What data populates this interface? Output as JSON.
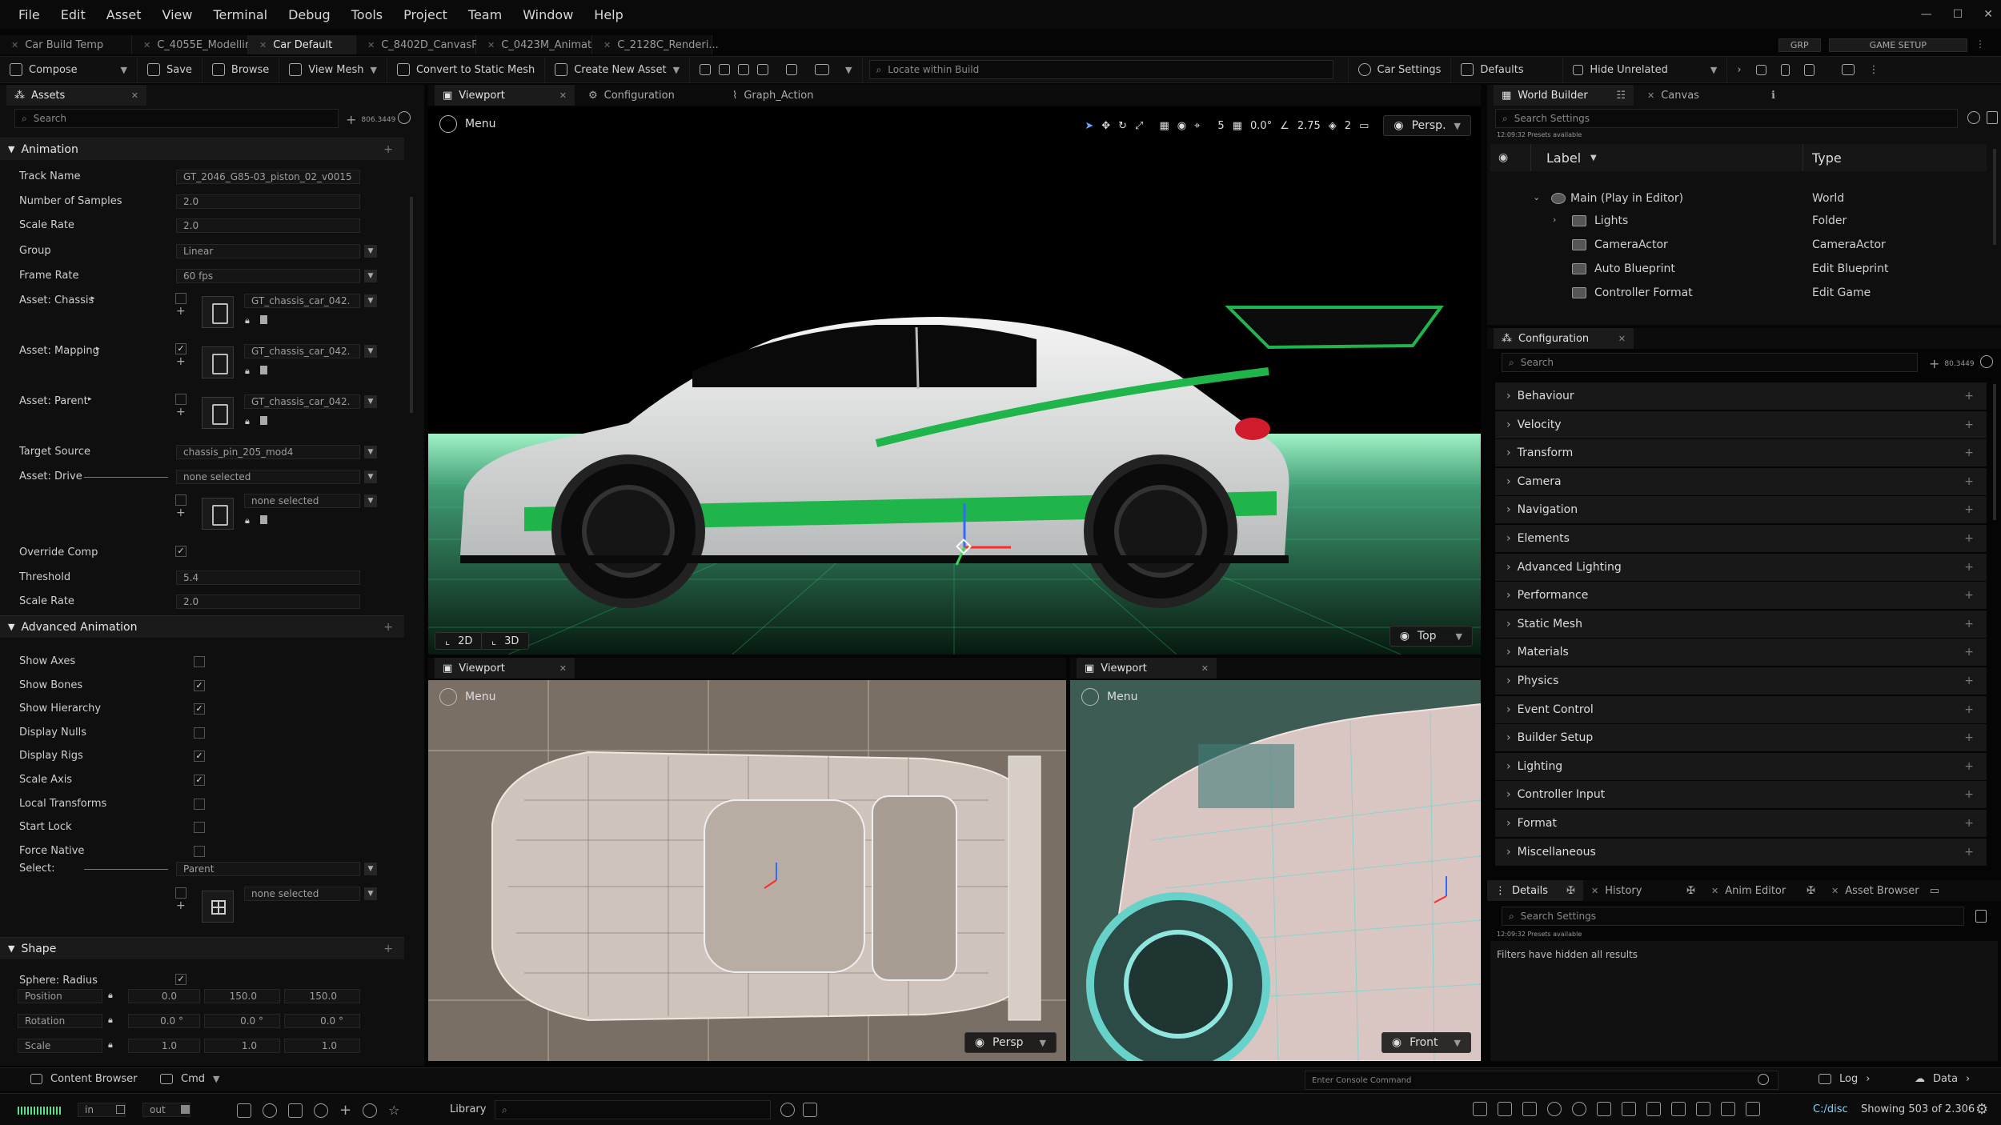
{
  "menu": [
    "File",
    "Edit",
    "Asset",
    "View",
    "Terminal",
    "Debug",
    "Tools",
    "Project",
    "Team",
    "Window",
    "Help"
  ],
  "doc_tabs": [
    {
      "label": "Car Build Temp",
      "active": false
    },
    {
      "label": "C_4055E_Modellin...",
      "active": false
    },
    {
      "label": "Car Default",
      "active": true
    },
    {
      "label": "C_8402D_CanvasF...",
      "active": false
    },
    {
      "label": "C_0423M_Animati...",
      "active": false
    },
    {
      "label": "C_2128C_Renderi...",
      "active": false
    }
  ],
  "top_chips": [
    "GRP",
    "GAME SETUP"
  ],
  "toolbar": {
    "compose": "Compose",
    "save": "Save",
    "browse": "Browse",
    "view_mesh": "View Mesh",
    "convert": "Convert to Static Mesh",
    "create_asset": "Create New Asset",
    "locate_placeholder": "Locate within Build",
    "car_settings": "Car Settings",
    "defaults": "Defaults",
    "hide_unrelated": "Hide Unrelated"
  },
  "assets_panel": {
    "tab": "Assets",
    "search": "Search",
    "count": "806.3449",
    "animation": {
      "title": "Animation",
      "track_name_label": "Track Name",
      "track_name": "GT_2046_G85-03_piston_02_v0015",
      "samples_label": "Number of Samples",
      "samples": "2.0",
      "scale_rate_label": "Scale Rate",
      "scale_rate": "2.0",
      "group_label": "Group",
      "group": "Linear",
      "frame_rate_label": "Frame Rate",
      "frame_rate": "60 fps",
      "chassis_label": "Asset: Chassis",
      "chassis": "GT_chassis_car_042.",
      "mapping_label": "Asset: Mapping",
      "mapping": "GT_chassis_car_042.",
      "parent_label": "Asset: Parent",
      "parent": "GT_chassis_car_042.",
      "target_label": "Target Source",
      "target": "chassis_pin_205_mod4",
      "drive_label": "Asset: Drive",
      "drive": "none selected",
      "drive2": "none selected",
      "override_label": "Override Comp",
      "threshold_label": "Threshold",
      "threshold": "5.4",
      "scale_rate2_label": "Scale Rate",
      "scale_rate2": "2.0"
    },
    "advanced": {
      "title": "Advanced Animation",
      "items": [
        {
          "label": "Show Axes",
          "checked": false
        },
        {
          "label": "Show Bones",
          "checked": true
        },
        {
          "label": "Show Hierarchy",
          "checked": true
        },
        {
          "label": "Display Nulls",
          "checked": false
        },
        {
          "label": "Display Rigs",
          "checked": true
        },
        {
          "label": "Scale Axis",
          "checked": true
        },
        {
          "label": "Local Transforms",
          "checked": false
        },
        {
          "label": "Start Lock",
          "checked": false
        },
        {
          "label": "Force Native",
          "checked": false
        }
      ],
      "select_label": "Select:",
      "select_value": "Parent",
      "select2": "none selected"
    },
    "shape": {
      "title": "Shape",
      "sphere_label": "Sphere: Radius",
      "position_label": "Position",
      "position": [
        "0.0",
        "150.0",
        "150.0"
      ],
      "rotation_label": "Rotation",
      "rotation": [
        "0.0 °",
        "0.0 °",
        "0.0 °"
      ],
      "scale_label": "Scale",
      "scale": [
        "1.0",
        "1.0",
        "1.0"
      ]
    }
  },
  "viewport_main": {
    "tabs": [
      "Viewport",
      "Configuration",
      "Graph_Action"
    ],
    "menu": "Menu",
    "toolbar_vals": [
      "5",
      "0.0°",
      "2.75",
      "2"
    ],
    "persp": "Persp.",
    "btn2d": "2D",
    "btn3d": "3D",
    "view": "Top"
  },
  "viewport_bl": {
    "tab": "Viewport",
    "menu": "Menu",
    "view": "Persp"
  },
  "viewport_br": {
    "tab": "Viewport",
    "menu": "Menu",
    "view": "Front"
  },
  "world_builder": {
    "tab": "World Builder",
    "tab2": "Canvas",
    "search": "Search Settings",
    "meta": "12:09:32 Presets available",
    "col_label": "Label",
    "col_type": "Type",
    "rows": [
      {
        "label": "Main (Play in Editor)",
        "type": "World"
      },
      {
        "label": "Lights",
        "type": "Folder"
      },
      {
        "label": "CameraActor",
        "type": "CameraActor"
      },
      {
        "label": "Auto Blueprint",
        "type": "Edit Blueprint"
      },
      {
        "label": "Controller Format",
        "type": "Edit Game"
      }
    ]
  },
  "configuration": {
    "tab": "Configuration",
    "search": "Search",
    "count": "80.3449",
    "sections": [
      "Behaviour",
      "Velocity",
      "Transform",
      "Camera",
      "Navigation",
      "Elements",
      "Advanced Lighting",
      "Performance",
      "Static Mesh",
      "Materials",
      "Physics",
      "Event Control",
      "Builder Setup",
      "Lighting",
      "Controller Input",
      "Format",
      "Miscellaneous"
    ]
  },
  "details": {
    "tabs": [
      "Details",
      "History",
      "Anim Editor",
      "Asset Browser"
    ],
    "search": "Search Settings",
    "meta": "12:09:32 Presets available",
    "message": "Filters have hidden all results"
  },
  "bottom": {
    "content_browser": "Content Browser",
    "cmd": "Cmd",
    "console": "Enter Console Command",
    "log": "Log",
    "data": "Data"
  },
  "status": {
    "in": "in",
    "out": "out",
    "library": "Library",
    "path": "C:/disc",
    "showing": "Showing 503 of 2.306"
  },
  "colors": {
    "accent_green": "#22c24a",
    "bg": "#050505",
    "panel": "#0f0f0f"
  }
}
